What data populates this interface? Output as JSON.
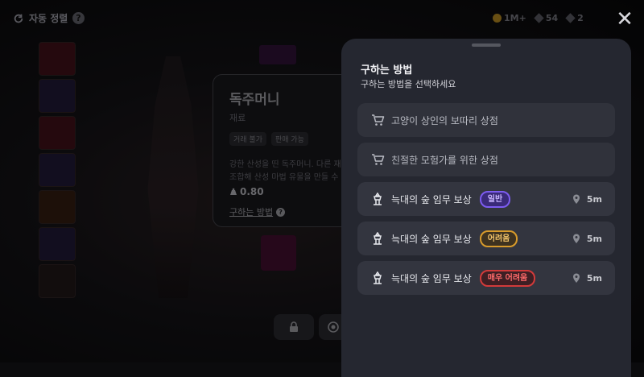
{
  "colors": {
    "panel_bg": "#252730",
    "row_bg": "#33353f",
    "normal_badge": "#7d5cf0",
    "hard_badge": "#d89b2b",
    "very_hard_badge": "#d23a3a"
  },
  "topbar": {
    "auto_sort_label": "자동 정렬",
    "help_label": "?",
    "currencies": [
      {
        "icon": "coin-icon",
        "value": "1M+"
      },
      {
        "icon": "gem-icon",
        "value": "54"
      },
      {
        "icon": "weight-icon",
        "value": "2"
      }
    ]
  },
  "item": {
    "name": "독주머니",
    "type": "재료",
    "tags": [
      "거래 불가",
      "판매 가능"
    ],
    "description_line1": "강한 산성을 띤 독주머니. 다른 재",
    "description_line2": "조합해 산성 마법 유물을 만들 수",
    "weight": "0.80",
    "how_to_link": "구하는 방법"
  },
  "panel": {
    "title": "구하는 방법",
    "subtitle": "구하는 방법을 선택하세요",
    "methods": [
      {
        "kind": "shop",
        "icon": "cart-icon",
        "label": "고양이 상인의 보따리 상점"
      },
      {
        "kind": "shop",
        "icon": "cart-icon",
        "label": "친절한 모험가를 위한 상점"
      },
      {
        "kind": "quest",
        "icon": "quest-icon",
        "label": "늑대의 숲 임무 보상",
        "difficulty": "일반",
        "distance": "5m"
      },
      {
        "kind": "quest",
        "icon": "quest-icon",
        "label": "늑대의 숲 임무 보상",
        "difficulty": "어려움",
        "distance": "5m"
      },
      {
        "kind": "quest",
        "icon": "quest-icon",
        "label": "늑대의 숲 임무 보상",
        "difficulty": "매우 어려움",
        "distance": "5m"
      }
    ]
  }
}
